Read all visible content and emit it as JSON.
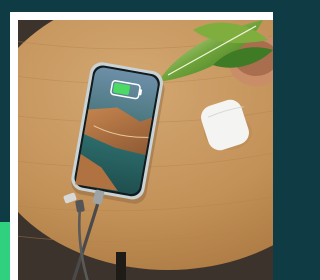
{
  "image": {
    "subject": "smartphone-charging-on-wooden-table",
    "elements": [
      "smartphone",
      "charging-cable",
      "earbuds-case",
      "plant-leaves",
      "round-wooden-table"
    ]
  },
  "colors": {
    "background": "#0f3b45",
    "accent_strip": "#2fd07f",
    "frame": "#ffffff",
    "wood": "#c89a62",
    "floor": "#3c342c"
  }
}
